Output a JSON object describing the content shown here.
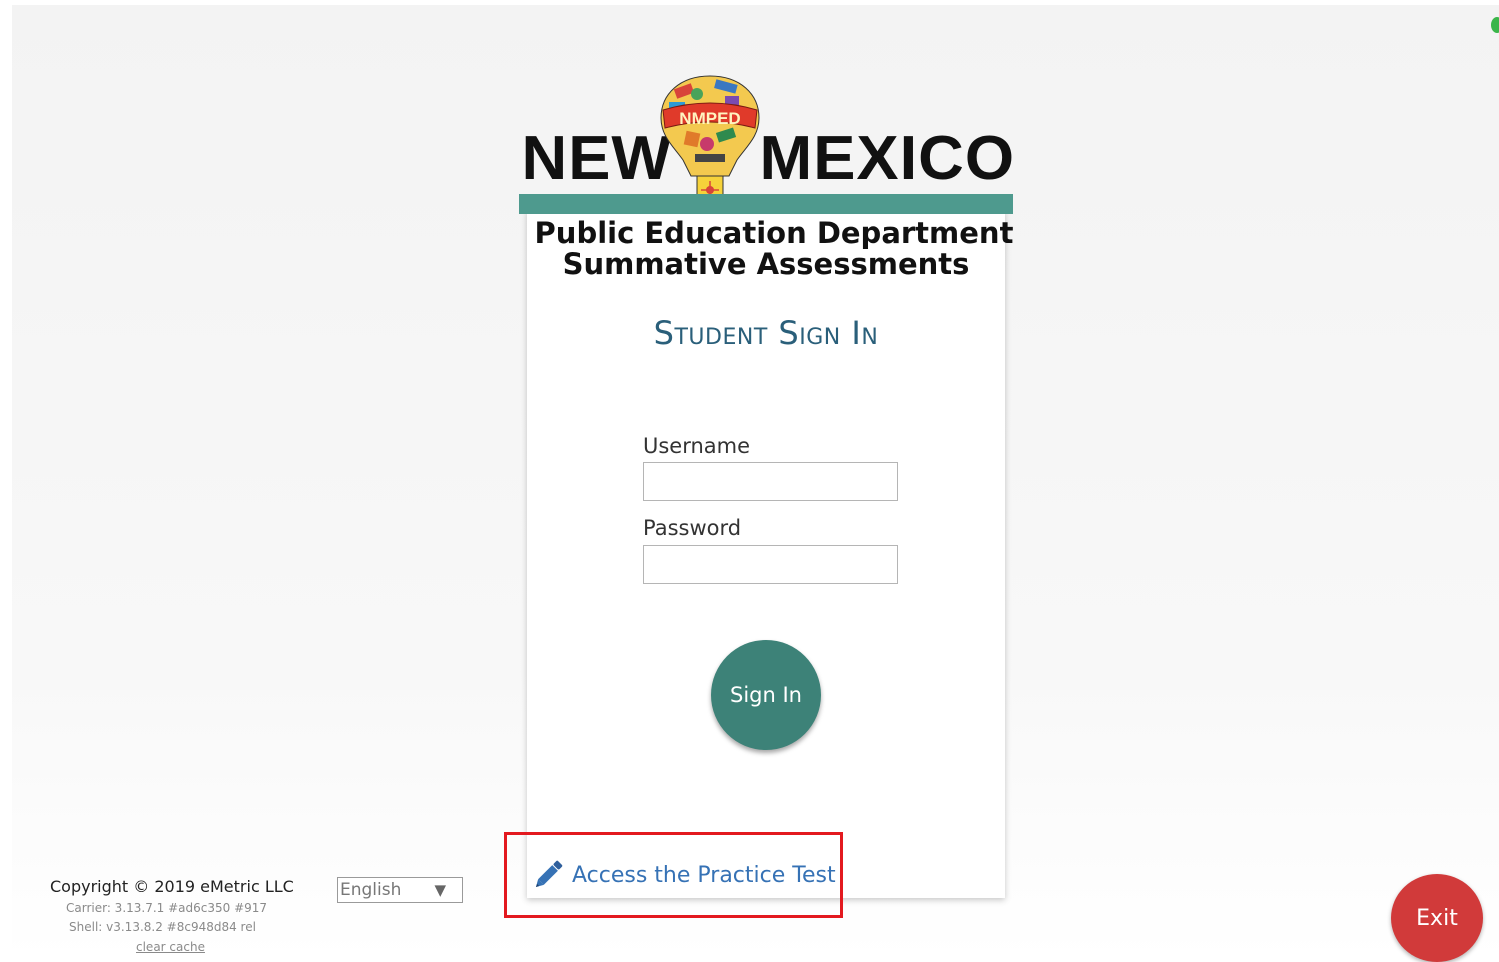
{
  "logo": {
    "word_left": "NEW",
    "word_right": "MEXICO",
    "emblem_text": "NMPED",
    "subtitle_line1": "Public Education Department",
    "subtitle_line2": "Summative Assessments",
    "bar_color": "#4e9a8e"
  },
  "signin_card": {
    "title": "Student Sign In",
    "username_label": "Username",
    "username_value": "",
    "password_label": "Password",
    "password_value": "",
    "signin_button_label": "Sign In",
    "button_color": "#3d8278"
  },
  "practice": {
    "link_text": "Access the Practice Test",
    "icon": "pencil-icon",
    "highlight_color": "#e3191f"
  },
  "footer": {
    "copyright": "Copyright © 2019 eMetric LLC",
    "carrier": "Carrier: 3.13.7.1 #ad6c350 #917",
    "shell": "Shell: v3.13.8.2  #8c948d84   rel",
    "clear_cache": "clear cache",
    "language": "English",
    "language_arrow": "▼"
  },
  "exit": {
    "label": "Exit",
    "color": "#d13a3a"
  }
}
